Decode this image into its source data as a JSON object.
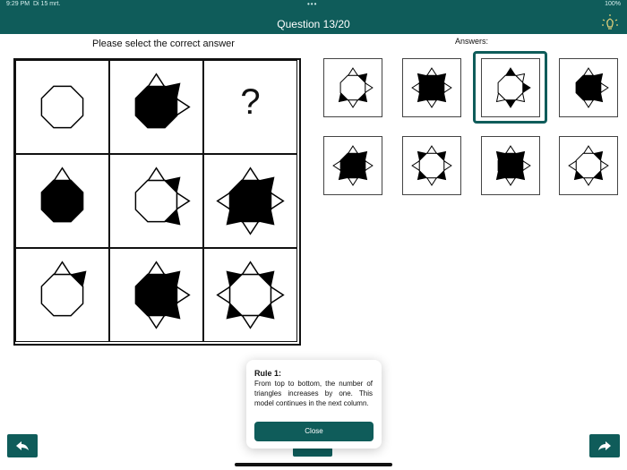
{
  "status": {
    "time": "9:29 PM",
    "date": "Di 15 mrt.",
    "battery": "100%"
  },
  "header": {
    "title": "Question 13/20"
  },
  "instruction": "Please select the correct answer",
  "answers_label": "Answers:",
  "puzzle": {
    "cells": [
      {
        "row": 1,
        "col": 1,
        "octagon": "white",
        "triangles": []
      },
      {
        "row": 1,
        "col": 2,
        "octagon": "black",
        "triangles": [
          [
            "top",
            "white"
          ],
          [
            "upper-right",
            "black"
          ],
          [
            "right",
            "white"
          ]
        ]
      },
      {
        "row": 1,
        "col": 3,
        "question_mark": "?"
      },
      {
        "row": 2,
        "col": 1,
        "octagon": "black",
        "triangles": [
          [
            "top",
            "white"
          ]
        ]
      },
      {
        "row": 2,
        "col": 2,
        "octagon": "white",
        "triangles": [
          [
            "top",
            "white"
          ],
          [
            "upper-right",
            "black"
          ],
          [
            "right",
            "white"
          ],
          [
            "lower-right",
            "black"
          ]
        ]
      },
      {
        "row": 2,
        "col": 3,
        "octagon": "black",
        "triangles": [
          [
            "top",
            "white"
          ],
          [
            "upper-right",
            "black"
          ],
          [
            "right",
            "white"
          ],
          [
            "lower-right",
            "black"
          ],
          [
            "bottom",
            "white"
          ],
          [
            "lower-left",
            "black"
          ],
          [
            "left",
            "white"
          ]
        ]
      },
      {
        "row": 3,
        "col": 1,
        "octagon": "white",
        "triangles": [
          [
            "top",
            "white"
          ],
          [
            "upper-right",
            "black"
          ]
        ]
      },
      {
        "row": 3,
        "col": 2,
        "octagon": "black",
        "triangles": [
          [
            "top",
            "white"
          ],
          [
            "upper-right",
            "black"
          ],
          [
            "right",
            "white"
          ],
          [
            "lower-right",
            "black"
          ],
          [
            "bottom",
            "white"
          ]
        ]
      },
      {
        "row": 3,
        "col": 3,
        "octagon": "white",
        "triangles": [
          [
            "top",
            "white"
          ],
          [
            "upper-right",
            "black"
          ],
          [
            "right",
            "white"
          ],
          [
            "lower-right",
            "black"
          ],
          [
            "bottom",
            "white"
          ],
          [
            "lower-left",
            "black"
          ],
          [
            "left",
            "white"
          ],
          [
            "upper-left",
            "black"
          ]
        ]
      }
    ]
  },
  "answers": [
    {
      "index": 1,
      "octagon": "white",
      "triangles": [
        [
          "top",
          "white"
        ],
        [
          "upper-right",
          "black"
        ],
        [
          "right",
          "white"
        ],
        [
          "lower-right",
          "black"
        ],
        [
          "bottom",
          "white"
        ],
        [
          "lower-left",
          "black"
        ]
      ]
    },
    {
      "index": 2,
      "octagon": "black",
      "triangles": [
        [
          "top",
          "white"
        ],
        [
          "upper-right",
          "black"
        ],
        [
          "right",
          "white"
        ],
        [
          "lower-right",
          "black"
        ],
        [
          "bottom",
          "white"
        ],
        [
          "lower-left",
          "black"
        ],
        [
          "left",
          "white"
        ],
        [
          "upper-left",
          "black"
        ]
      ]
    },
    {
      "index": 3,
      "octagon": "white",
      "selected": true,
      "triangles": [
        [
          "top",
          "black"
        ],
        [
          "upper-right",
          "white"
        ],
        [
          "right",
          "black"
        ],
        [
          "lower-right",
          "white"
        ],
        [
          "bottom",
          "black"
        ],
        [
          "lower-left",
          "white"
        ]
      ]
    },
    {
      "index": 4,
      "octagon": "black",
      "triangles": [
        [
          "top",
          "white"
        ],
        [
          "upper-right",
          "black"
        ],
        [
          "right",
          "white"
        ],
        [
          "lower-right",
          "black"
        ],
        [
          "bottom",
          "white"
        ]
      ]
    },
    {
      "index": 5,
      "octagon": "black",
      "triangles": [
        [
          "top",
          "white"
        ],
        [
          "upper-right",
          "black"
        ],
        [
          "right",
          "white"
        ],
        [
          "lower-right",
          "black"
        ],
        [
          "bottom",
          "white"
        ],
        [
          "lower-left",
          "black"
        ],
        [
          "left",
          "white"
        ]
      ]
    },
    {
      "index": 6,
      "octagon": "white",
      "triangles": [
        [
          "top",
          "white"
        ],
        [
          "upper-right",
          "black"
        ],
        [
          "right",
          "white"
        ],
        [
          "lower-right",
          "black"
        ],
        [
          "bottom",
          "white"
        ],
        [
          "lower-left",
          "black"
        ],
        [
          "left",
          "white"
        ],
        [
          "upper-left",
          "black"
        ]
      ]
    },
    {
      "index": 7,
      "octagon": "black",
      "triangles": [
        [
          "top",
          "white"
        ],
        [
          "upper-right",
          "black"
        ],
        [
          "right",
          "white"
        ],
        [
          "lower-right",
          "black"
        ],
        [
          "bottom",
          "white"
        ],
        [
          "lower-left",
          "black"
        ],
        [
          "upper-left",
          "black"
        ]
      ]
    },
    {
      "index": 8,
      "octagon": "white",
      "triangles": [
        [
          "top",
          "white"
        ],
        [
          "upper-right",
          "black"
        ],
        [
          "right",
          "white"
        ],
        [
          "lower-right",
          "black"
        ],
        [
          "bottom",
          "white"
        ],
        [
          "lower-left",
          "black"
        ],
        [
          "left",
          "white"
        ]
      ]
    }
  ],
  "popup": {
    "title": "Rule 1:",
    "text": "From top to bottom, the number of triangles increases by one. This model continues in the next column.",
    "close_label": "Close"
  },
  "icons": {
    "back": "back-arrow-icon",
    "forward": "forward-arrow-icon",
    "hint": "lightbulb-icon"
  },
  "colors": {
    "accent": "#0f5c5a"
  }
}
